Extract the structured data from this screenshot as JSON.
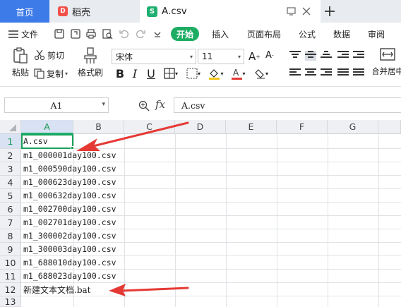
{
  "tabs": {
    "home": "首页",
    "daoke": "稻壳",
    "file": "A.csv",
    "logo_letter": "S",
    "daoke_logo_letter": "D"
  },
  "menu": {
    "file": "文件",
    "start": "开始",
    "insert": "插入",
    "page_layout": "页面布局",
    "formula": "公式",
    "data": "数据",
    "review": "审阅"
  },
  "ribbon": {
    "paste": "粘贴",
    "cut": "剪切",
    "copy": "复制",
    "format_painter": "格式刷",
    "font_name": "宋体",
    "font_size": "11",
    "merge": "合并居中"
  },
  "formula_bar": {
    "cell_ref": "A1",
    "content": "A.csv"
  },
  "sheet": {
    "columns": [
      "A",
      "B",
      "C",
      "D",
      "E",
      "F",
      "G"
    ],
    "rows": [
      "1",
      "2",
      "3",
      "4",
      "5",
      "6",
      "7",
      "8",
      "9",
      "10",
      "11",
      "12",
      "13"
    ],
    "cells": [
      "A.csv",
      "m1_000001day100.csv",
      "m1_000590day100.csv",
      "m1_000623day100.csv",
      "m1_000632day100.csv",
      "m1_002700day100.csv",
      "m1_002701day100.csv",
      "m1_300002day100.csv",
      "m1_300003day100.csv",
      "m1_688010day100.csv",
      "m1_688023day100.csv",
      "新建文本文档.bat",
      ""
    ]
  },
  "colors": {
    "accent_blue": "#3d7be8",
    "start_green": "#1cad63",
    "selection_green": "#1aa35c",
    "annotation_red": "#e53935"
  }
}
